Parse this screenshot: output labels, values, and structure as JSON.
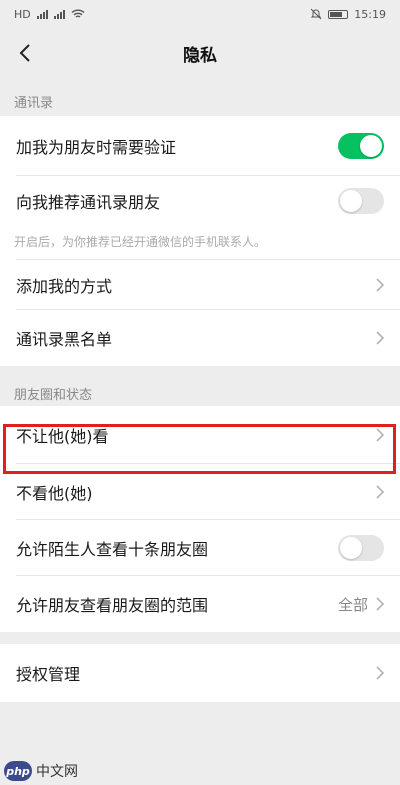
{
  "status_bar": {
    "left_text": "HD",
    "time": "15:19"
  },
  "nav": {
    "title": "隐私"
  },
  "sections": {
    "contacts": {
      "header": "通讯录",
      "require_verify": {
        "label": "加我为朋友时需要验证",
        "toggle": true
      },
      "recommend_contacts": {
        "label": "向我推荐通讯录朋友",
        "toggle": false,
        "hint": "开启后，为你推荐已经开通微信的手机联系人。"
      },
      "add_method": {
        "label": "添加我的方式"
      },
      "blacklist": {
        "label": "通讯录黑名单"
      }
    },
    "moments": {
      "header": "朋友圈和状态",
      "hide_from": {
        "label": "不让他(她)看"
      },
      "not_see": {
        "label": "不看他(她)"
      },
      "stranger_ten": {
        "label": "允许陌生人查看十条朋友圈",
        "toggle": false
      },
      "range": {
        "label": "允许朋友查看朋友圈的范围",
        "value": "全部"
      }
    },
    "auth": {
      "manage": {
        "label": "授权管理"
      }
    }
  },
  "watermark": {
    "logo": "php",
    "text": "中文网"
  },
  "colors": {
    "accent_green": "#07c160",
    "highlight_red": "#e02020",
    "background": "#ededed"
  }
}
